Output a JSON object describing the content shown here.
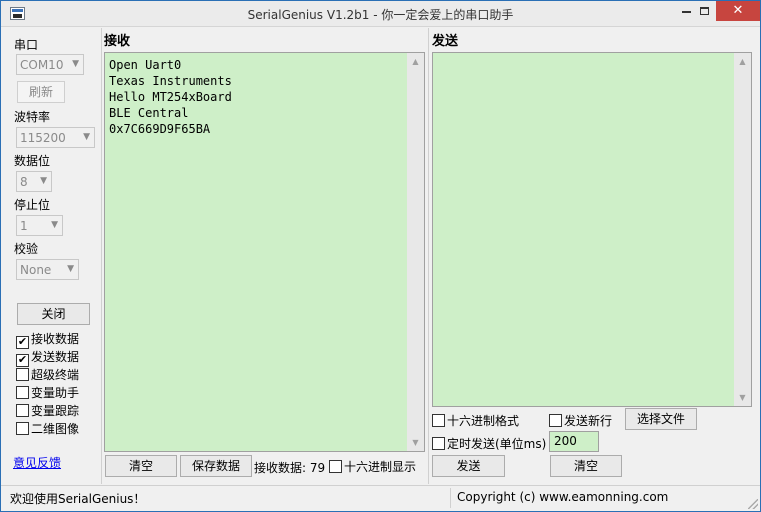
{
  "window": {
    "title": "SerialGenius V1.2b1 - 你一定会爱上的串口助手"
  },
  "sidebar": {
    "port_label": "串口",
    "port_value": "COM10",
    "refresh_label": "刷新",
    "baud_label": "波特率",
    "baud_value": "115200",
    "databits_label": "数据位",
    "databits_value": "8",
    "stopbits_label": "停止位",
    "stopbits_value": "1",
    "parity_label": "校验",
    "parity_value": "None",
    "close_label": "关闭",
    "options": [
      {
        "label": "接收数据",
        "checked": true
      },
      {
        "label": "发送数据",
        "checked": true
      },
      {
        "label": "超级终端",
        "checked": false
      },
      {
        "label": "变量助手",
        "checked": false
      },
      {
        "label": "变量跟踪",
        "checked": false
      },
      {
        "label": "二维图像",
        "checked": false
      }
    ],
    "feedback_link": "意见反馈"
  },
  "receive": {
    "title": "接收",
    "lines": [
      "Open Uart0",
      "Texas Instruments",
      "Hello MT254xBoard",
      "BLE Central",
      "0x7C669D9F65BA"
    ],
    "clear_label": "清空",
    "save_label": "保存数据",
    "count_text": "接收数据: 79",
    "hex_label": "十六进制显示",
    "hex_checked": false
  },
  "send": {
    "title": "发送",
    "hex_format_label": "十六进制格式",
    "newline_label": "发送新行",
    "choose_file_label": "选择文件",
    "timed_label": "定时发送(单位ms)",
    "interval_value": "200",
    "send_label": "发送",
    "clear_label": "清空"
  },
  "statusbar": {
    "welcome": "欢迎使用SerialGenius！",
    "copyright": "Copyright (c) www.eamonning.com"
  },
  "check_glyph": "✔"
}
